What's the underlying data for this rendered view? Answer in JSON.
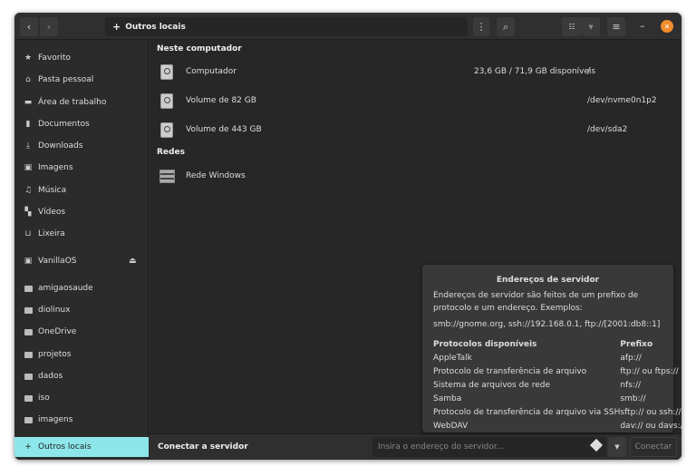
{
  "header": {
    "location": "Outros locais",
    "back_icon": "chevron-left",
    "forward_icon": "chevron-right"
  },
  "sidebar": {
    "items": [
      {
        "label": "Favorito",
        "icon": "star"
      },
      {
        "label": "Pasta pessoal",
        "icon": "home"
      },
      {
        "label": "Área de trabalho",
        "icon": "desktop"
      },
      {
        "label": "Documentos",
        "icon": "document"
      },
      {
        "label": "Downloads",
        "icon": "download"
      },
      {
        "label": "Imagens",
        "icon": "image"
      },
      {
        "label": "Música",
        "icon": "music"
      },
      {
        "label": "Vídeos",
        "icon": "video"
      },
      {
        "label": "Lixeira",
        "icon": "trash"
      },
      {
        "label": "VanillaOS",
        "icon": "drive"
      },
      {
        "label": "amigaosaude",
        "icon": "folder"
      },
      {
        "label": "diolinux",
        "icon": "folder"
      },
      {
        "label": "OneDrive",
        "icon": "folder"
      },
      {
        "label": "projetos",
        "icon": "folder"
      },
      {
        "label": "dados",
        "icon": "folder"
      },
      {
        "label": "iso",
        "icon": "folder"
      },
      {
        "label": "imagens",
        "icon": "folder"
      },
      {
        "label": "Outros locais",
        "icon": "plus"
      }
    ]
  },
  "main": {
    "this_computer": "Neste computador",
    "networks": "Redes",
    "drives": [
      {
        "name": "Computador",
        "size": "23,6 GB / 71,9 GB disponíveis",
        "mount": "/"
      },
      {
        "name": "Volume de 82 GB",
        "size": "",
        "mount": "/dev/nvme0n1p2"
      },
      {
        "name": "Volume de 443 GB",
        "size": "",
        "mount": "/dev/sda2"
      }
    ],
    "network_items": [
      {
        "name": "Rede Windows"
      }
    ]
  },
  "bottom": {
    "label": "Conectar a servidor",
    "placeholder": "Insira o endereço do servidor...",
    "connect": "Conectar"
  },
  "popover": {
    "title": "Endereços de servidor",
    "desc": "Endereços de servidor são feitos de um prefixo de protocolo e um endereço. Exemplos:",
    "examples": "smb://gnome.org, ssh://192.168.0.1, ftp://[2001:db8::1]",
    "col1": "Protocolos disponíveis",
    "col2": "Prefixo",
    "rows": [
      {
        "p": "AppleTalk",
        "x": "afp://"
      },
      {
        "p": "Protocolo de transferência de arquivo",
        "x": "ftp:// ou ftps://"
      },
      {
        "p": "Sistema de arquivos de rede",
        "x": "nfs://"
      },
      {
        "p": "Samba",
        "x": "smb://"
      },
      {
        "p": "Protocolo de transferência de arquivo via SSH",
        "x": "sftp:// ou ssh://"
      },
      {
        "p": "WebDAV",
        "x": "dav:// ou davs://"
      }
    ]
  },
  "colors": {
    "selected": "#8de7ea",
    "close": "#f08c2a"
  }
}
